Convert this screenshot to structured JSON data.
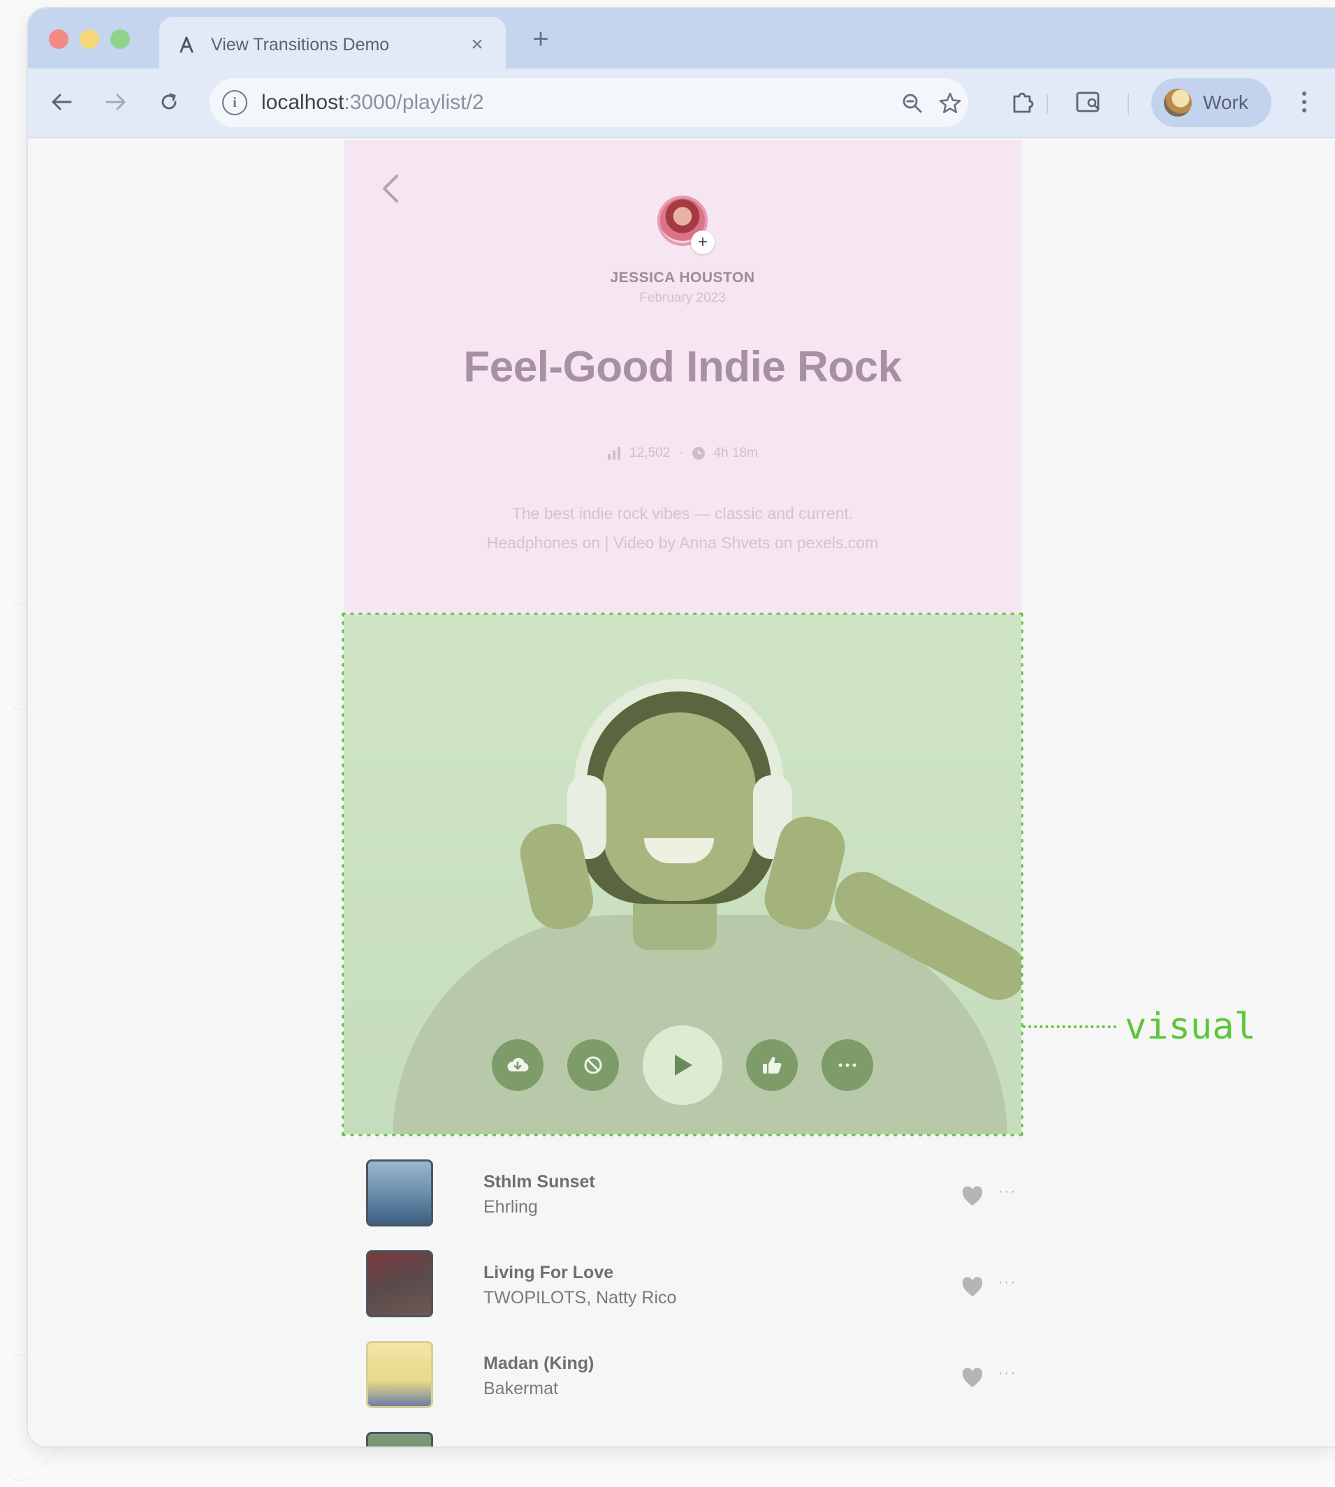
{
  "browser": {
    "tab_title": "View Transitions Demo",
    "url_host": "localhost",
    "url_path": ":3000/playlist/2",
    "profile_label": "Work"
  },
  "playlist": {
    "author": "JESSICA HOUSTON",
    "date": "February 2023",
    "title": "Feel-Good Indie Rock",
    "plays": "12,502",
    "separator": "·",
    "duration": "4h 18m",
    "description": "The best indie rock vibes — classic and current. Headphones on | Video by Anna Shvets on pexels.com"
  },
  "annotation": {
    "label": "visual"
  },
  "controls": [
    "download-icon",
    "block-icon",
    "play-icon",
    "thumbs-up-icon",
    "more-icon"
  ],
  "tracks": [
    {
      "title": "Sthlm Sunset",
      "artist": "Ehrling",
      "more": "···"
    },
    {
      "title": "Living For Love",
      "artist": "TWOPILOTS, Natty Rico",
      "more": "···"
    },
    {
      "title": "Madan (King)",
      "artist": "Bakermat",
      "more": "···"
    }
  ],
  "colors": {
    "tabstrip": "#c5d5ef",
    "header_panel": "#f5e6f1",
    "annotation": "#5cc73a"
  }
}
